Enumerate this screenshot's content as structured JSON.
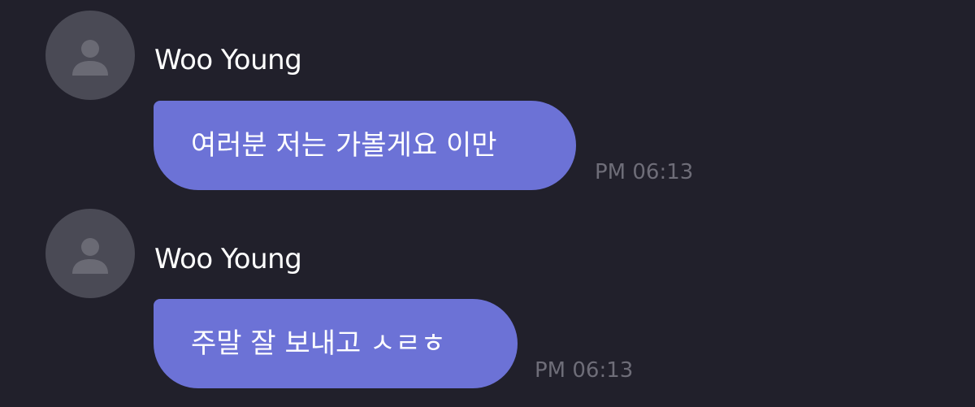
{
  "messages": [
    {
      "sender": "Woo Young",
      "text": "여러분 저는 가볼게요 이만",
      "time": "PM 06:13",
      "avatar_icon": "default-user-icon"
    },
    {
      "sender": "Woo Young",
      "text": "주말 잘 보내고 ㅅㄹㅎ",
      "time": "PM 06:13",
      "avatar_icon": "default-user-icon"
    }
  ],
  "colors": {
    "background": "#21202b",
    "bubble": "#6c72d6",
    "avatar": "#4a4a55",
    "avatar_glyph": "#6a6a74",
    "sender_text": "#ffffff",
    "timestamp": "#6e6d78"
  }
}
